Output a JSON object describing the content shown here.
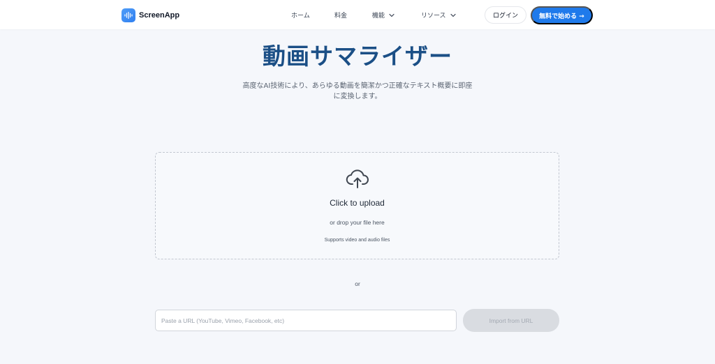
{
  "nav": {
    "brand": "ScreenApp",
    "links": [
      {
        "label": "ホーム"
      },
      {
        "label": "料金"
      },
      {
        "label": "機能"
      },
      {
        "label": "リソース"
      }
    ],
    "login": "ログイン",
    "cta": "無料で始める →"
  },
  "hero": {
    "title": "動画サマライザー",
    "subtitle_line1": "高度なAI技術により、あらゆる動画を簡潔かつ正確なテキスト概要に即座",
    "subtitle_line2": "に変換します。"
  },
  "upload": {
    "title": "Click to upload",
    "subtitle": "or drop your file here",
    "note": "Supports video and audio files"
  },
  "divider": "or",
  "url": {
    "placeholder": "Paste a URL (YouTube, Vimeo, Facebook, etc)",
    "button": "Import from URL"
  },
  "colors": {
    "accent": "#1f7aeb",
    "title": "#1b4f86",
    "background": "#f5f7fb"
  },
  "icons": {
    "brand": "waveform-icon",
    "upload": "cloud-upload-icon",
    "dropdown": "chevron-down-icon"
  }
}
